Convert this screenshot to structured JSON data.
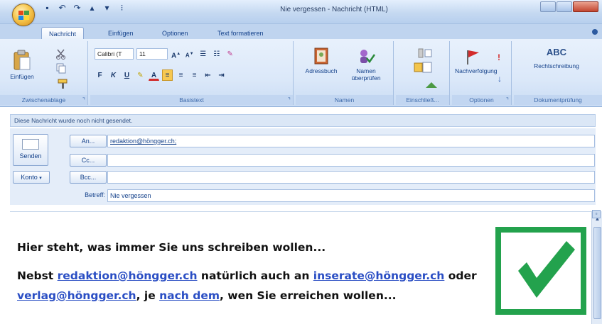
{
  "window": {
    "title": "Nie vergessen - Nachricht (HTML)"
  },
  "tabs": [
    {
      "label": "Nachricht",
      "active": true
    },
    {
      "label": "Einfügen",
      "active": false
    },
    {
      "label": "Optionen",
      "active": false
    },
    {
      "label": "Text formatieren",
      "active": false
    }
  ],
  "ribbon": {
    "clipboard": {
      "paste_label": "Einfügen",
      "group_label": "Zwischenablage"
    },
    "basic_text": {
      "font_name": "Calibri (T",
      "font_size": "11",
      "group_label": "Basistext"
    },
    "names": {
      "address_book_label": "Adressbuch",
      "check_names_label": "Namen überprüfen",
      "group_label": "Namen"
    },
    "include": {
      "group_label": "Einschließ..."
    },
    "options": {
      "followup_label": "Nachverfolgung",
      "group_label": "Optionen"
    },
    "proofing": {
      "spelling_label": "Rechtschreibung",
      "abc_label": "ABC",
      "group_label": "Dokumentprüfung"
    }
  },
  "infobar": {
    "text": "Diese Nachricht wurde noch nicht gesendet."
  },
  "header": {
    "send_label": "Senden",
    "to_label": "An...",
    "cc_label": "Cc...",
    "bcc_label": "Bcc...",
    "account_label": "Konto",
    "subject_label": "Betreff:",
    "to_value": "redaktion@höngger.ch;",
    "cc_value": "",
    "bcc_value": "",
    "subject_value": "Nie vergessen"
  },
  "body": {
    "line1": "Hier steht, was immer Sie uns schreiben wollen...",
    "p2_prefix": "Nebst ",
    "link1": "redaktion@höngger.ch",
    "p2_mid": " natürlich auch an ",
    "link2": "inserate@höngger.ch",
    "p2_or": " oder",
    "link3": "verlag@höngger.ch",
    "p2_comma": ", je ",
    "link4": "nach dem",
    "p2_suffix": ", wen Sie erreichen wollen..."
  },
  "colors": {
    "check_green": "#23a24d",
    "link_blue": "#2a4ec4"
  }
}
